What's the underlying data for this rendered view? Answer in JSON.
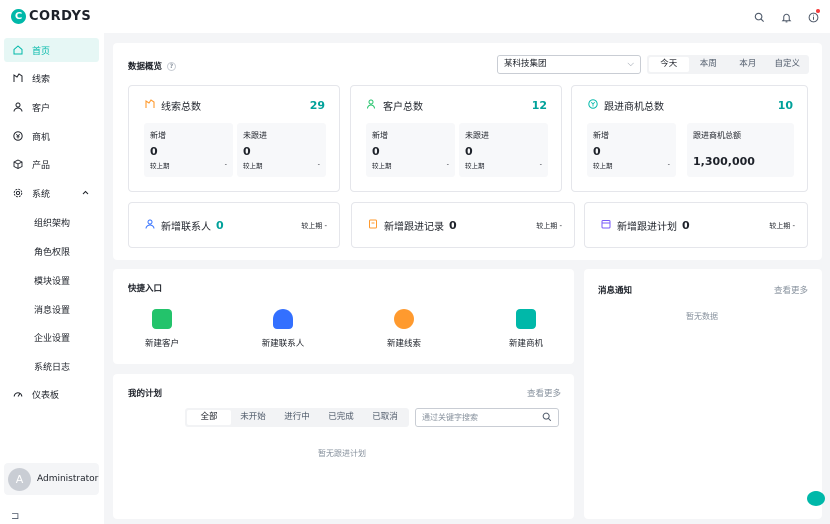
{
  "app": {
    "logo_letter": "C",
    "logo_text": "CORDYS"
  },
  "header": {
    "icons": [
      "search-icon",
      "bell-icon",
      "info-icon"
    ]
  },
  "sidebar": {
    "items": [
      {
        "label": "首页",
        "icon": "home-icon"
      },
      {
        "label": "线索",
        "icon": "leads-icon"
      },
      {
        "label": "客户",
        "icon": "customer-icon"
      },
      {
        "label": "商机",
        "icon": "opportunity-icon"
      },
      {
        "label": "产品",
        "icon": "product-icon"
      },
      {
        "label": "系统",
        "icon": "gear-icon"
      },
      {
        "label": "仪表板",
        "icon": "dashboard-icon"
      }
    ],
    "system_sub": [
      "组织架构",
      "角色权限",
      "模块设置",
      "消息设置",
      "企业设置",
      "系统日志"
    ],
    "user": {
      "avatar_letter": "A",
      "name": "Administrator"
    },
    "collapse_glyph": "⊐"
  },
  "overview": {
    "title": "数据概览",
    "org_select": "某科技集团",
    "periods": [
      "今天",
      "本周",
      "本月",
      "自定义"
    ],
    "cards": [
      {
        "title": "线索总数",
        "total": "29",
        "subs": [
          {
            "label": "新增",
            "value": "0",
            "cmp": "较上期",
            "delta": "-"
          },
          {
            "label": "未跟进",
            "value": "0",
            "cmp": "较上期",
            "delta": "-"
          }
        ]
      },
      {
        "title": "客户总数",
        "total": "12",
        "subs": [
          {
            "label": "新增",
            "value": "0",
            "cmp": "较上期",
            "delta": "-"
          },
          {
            "label": "未跟进",
            "value": "0",
            "cmp": "较上期",
            "delta": "-"
          }
        ]
      },
      {
        "title": "跟进商机总数",
        "total": "10",
        "subs": [
          {
            "label": "新增",
            "value": "0",
            "cmp": "较上期",
            "delta": "-"
          },
          {
            "label": "跟进商机总额",
            "value": "1,300,000"
          }
        ]
      }
    ],
    "small_cards": [
      {
        "title": "新增联系人",
        "value": "0",
        "cmp": "较上期 -"
      },
      {
        "title": "新增跟进记录",
        "value": "0",
        "cmp": "较上期 -"
      },
      {
        "title": "新增跟进计划",
        "value": "0",
        "cmp": "较上期 -"
      }
    ]
  },
  "quick": {
    "title": "快捷入口",
    "items": [
      {
        "label": "新建客户",
        "color": "#23c36b"
      },
      {
        "label": "新建联系人",
        "color": "#3370ff"
      },
      {
        "label": "新建线索",
        "color": "#ff9a2e"
      },
      {
        "label": "新建商机",
        "color": "#00b8a9"
      }
    ]
  },
  "plan": {
    "title": "我的计划",
    "more": "查看更多",
    "tabs": [
      "全部",
      "未开始",
      "进行中",
      "已完成",
      "已取消"
    ],
    "search_placeholder": "通过关键字搜索",
    "empty": "暂无跟进计划"
  },
  "notice": {
    "title": "消息通知",
    "more": "查看更多",
    "empty": "暂无数据"
  },
  "colors": {
    "accent": "#00b8a9",
    "number": "#00a19a"
  }
}
